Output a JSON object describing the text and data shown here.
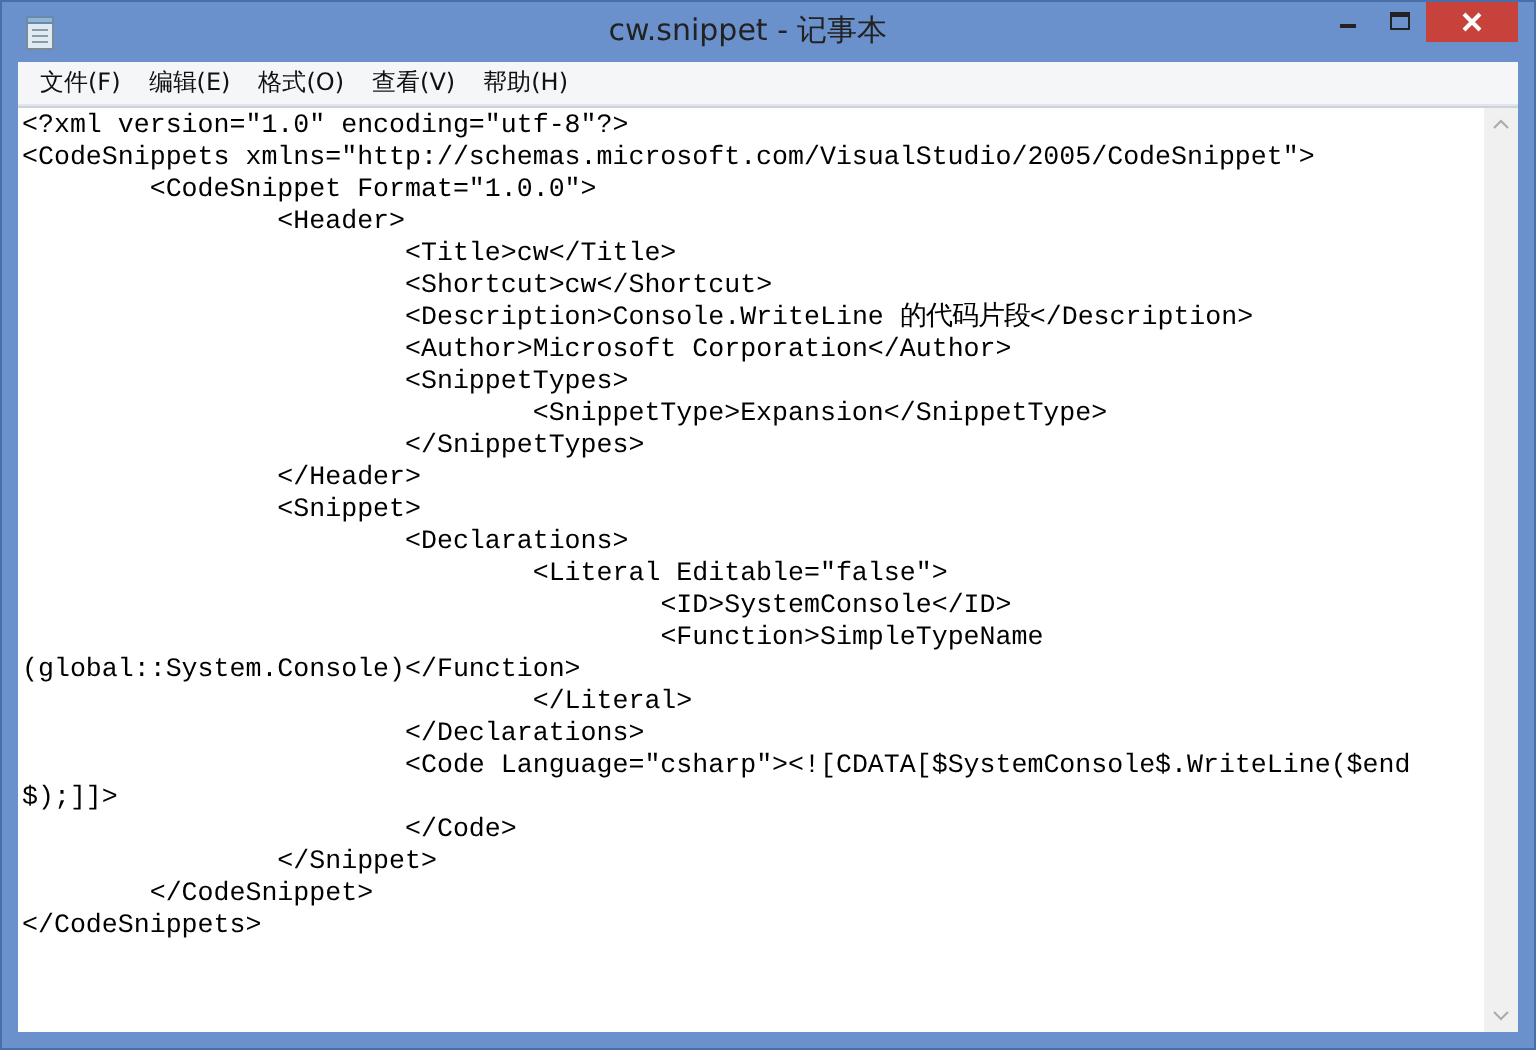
{
  "window": {
    "title": "cw.snippet - 记事本"
  },
  "menu": [
    "文件(F)",
    "编辑(E)",
    "格式(O)",
    "查看(V)",
    "帮助(H)"
  ],
  "editor": {
    "lines": [
      "<?xml version=\"1.0\" encoding=\"utf-8\"?>",
      "<CodeSnippets xmlns=\"http://schemas.microsoft.com/VisualStudio/2005/CodeSnippet\">",
      "\t<CodeSnippet Format=\"1.0.0\">",
      "\t\t<Header>",
      "\t\t\t<Title>cw</Title>",
      "\t\t\t<Shortcut>cw</Shortcut>",
      "\t\t\t<Description>Console.WriteLine 的代码片段</Description>",
      "\t\t\t<Author>Microsoft Corporation</Author>",
      "\t\t\t<SnippetTypes>",
      "\t\t\t\t<SnippetType>Expansion</SnippetType>",
      "\t\t\t</SnippetTypes>",
      "\t\t</Header>",
      "\t\t<Snippet>",
      "\t\t\t<Declarations>",
      "\t\t\t\t<Literal Editable=\"false\">",
      "\t\t\t\t\t<ID>SystemConsole</ID>",
      "\t\t\t\t\t<Function>SimpleTypeName",
      "(global::System.Console)</Function>",
      "\t\t\t\t</Literal>",
      "\t\t\t</Declarations>",
      "\t\t\t<Code Language=\"csharp\"><![CDATA[$SystemConsole$.WriteLine($end",
      "$);]]>",
      "\t\t\t</Code>",
      "\t\t</Snippet>",
      "\t</CodeSnippet>",
      "</CodeSnippets>"
    ]
  }
}
